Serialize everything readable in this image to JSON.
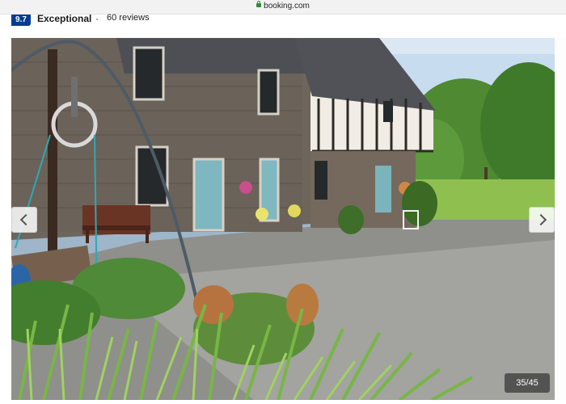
{
  "browser": {
    "url": "booking.com"
  },
  "review": {
    "score": "9.7",
    "rating_word": "Exceptional",
    "separator": "·",
    "count": "60 reviews"
  },
  "gallery": {
    "counter": "35/45",
    "prev_icon": "chevron-left-icon",
    "next_icon": "chevron-right-icon",
    "photo": "gallery-photo"
  },
  "colors": {
    "score_bg": "#003b95",
    "lock": "#2e8b3d"
  }
}
